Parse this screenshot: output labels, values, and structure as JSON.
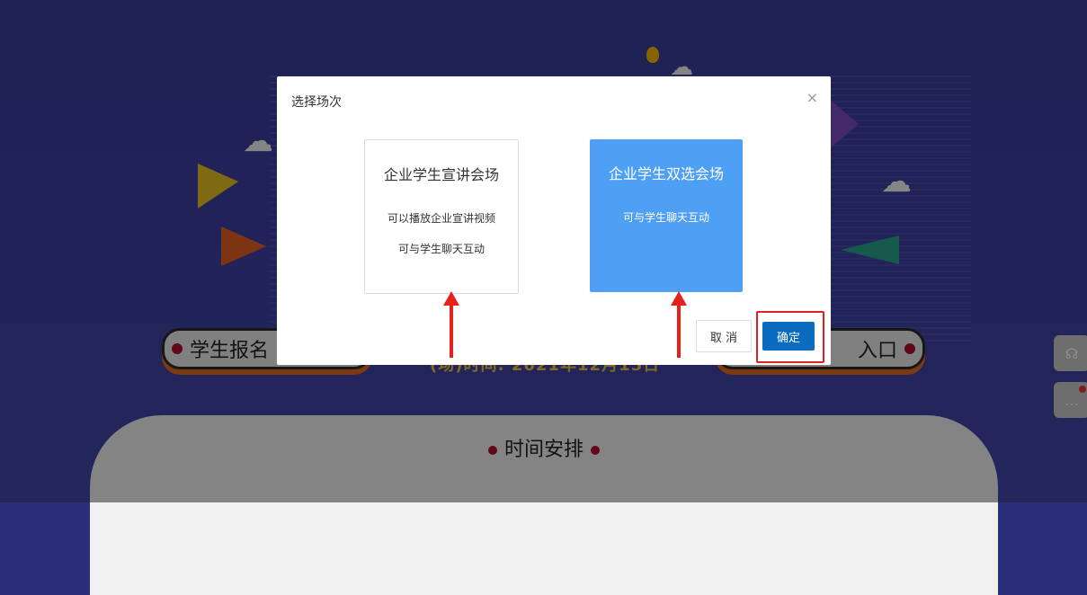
{
  "background": {
    "banner_left": "学生报名",
    "banner_right": "入口",
    "date_text": "(场)时间: 2021年12月15日",
    "time_panel_title": "时间安排"
  },
  "modal": {
    "title": "选择场次",
    "close_label": "×",
    "cards": [
      {
        "title": "企业学生宣讲会场",
        "lines": [
          "可以播放企业宣讲视频",
          "可与学生聊天互动"
        ]
      },
      {
        "title": "企业学生双选会场",
        "lines": [
          "可与学生聊天互动"
        ]
      }
    ],
    "cancel_label": "取 消",
    "ok_label": "确定"
  },
  "colors": {
    "selected_card": "#4ea0f5",
    "primary_button": "#0b6bbf",
    "annotation_red": "#e02020"
  },
  "side_icons": [
    "headset-icon",
    "chat-icon"
  ]
}
